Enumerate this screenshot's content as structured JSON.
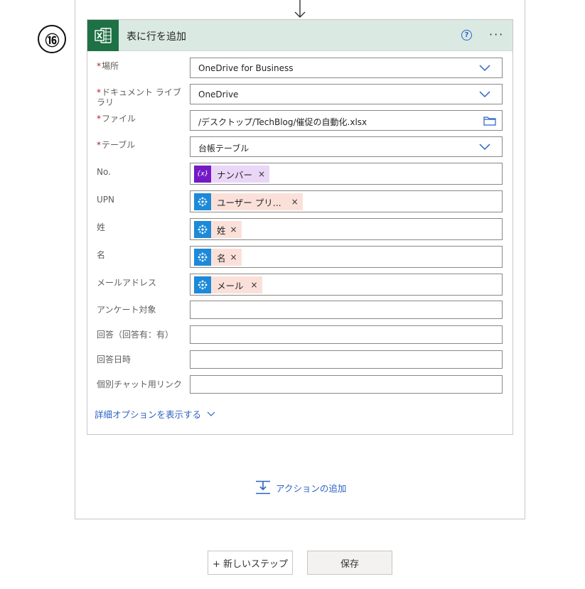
{
  "step_number": "⑯",
  "card": {
    "title": "表に行を追加",
    "help_label": "?",
    "more_label": "···"
  },
  "fields": {
    "location": {
      "label": "場所",
      "value": "OneDrive for Business"
    },
    "library": {
      "label": "ドキュメント ライブラリ",
      "value": "OneDrive"
    },
    "file": {
      "label": "ファイル",
      "value": "/デスクトップ/TechBlog/催促の自動化.xlsx"
    },
    "table": {
      "label": "テーブル",
      "value": "台帳テーブル"
    },
    "no": {
      "label": "No.",
      "token": "ナンバー",
      "token_icon_label": "{x}"
    },
    "upn": {
      "label": "UPN",
      "token": "ユーザー プリ..."
    },
    "last_name": {
      "label": "姓",
      "token": "姓"
    },
    "first_name": {
      "label": "名",
      "token": "名"
    },
    "email": {
      "label": "メールアドレス",
      "token": "メール"
    },
    "survey": {
      "label": "アンケート対象",
      "value": ""
    },
    "answer": {
      "label": "回答（回答有：有）",
      "value": ""
    },
    "answer_date": {
      "label": "回答日時",
      "value": ""
    },
    "chat_link": {
      "label": "個別チャット用リンク",
      "value": ""
    }
  },
  "required_mark": "*",
  "token_remove": "×",
  "advanced_options": "詳細オプションを表示する",
  "add_action": "アクションの追加",
  "buttons": {
    "new_step": "+ 新しいステップ",
    "save": "保存"
  },
  "colors": {
    "excel_green": "#1e7145",
    "header_bg": "#dbe9e3",
    "link_blue": "#2b62c4",
    "variable_token": "#ead6f7",
    "user_token": "#fbe0da",
    "required": "#a4262c"
  },
  "icons": {
    "excel": "excel-icon",
    "help": "help-icon",
    "more": "more-icon",
    "chevron": "chevron-down-icon",
    "folder": "folder-icon",
    "variable": "variable-icon",
    "office365_users": "office365-users-icon",
    "add_action": "add-action-icon",
    "connector_arrow": "arrow-down-icon"
  }
}
